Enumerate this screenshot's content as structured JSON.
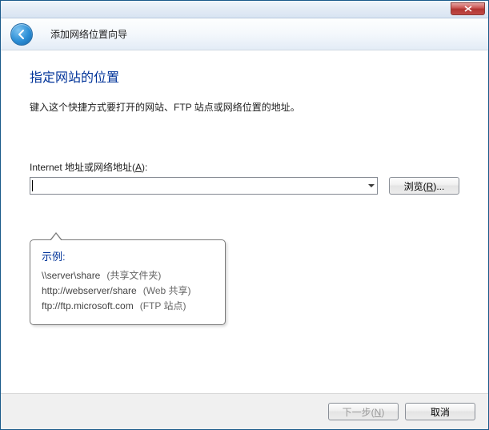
{
  "titlebar": {},
  "header": {
    "wizard_title": "添加网络位置向导"
  },
  "content": {
    "heading": "指定网站的位置",
    "instruction": "键入这个快捷方式要打开的网站、FTP 站点或网络位置的地址。",
    "field_label_prefix": "Internet 地址或网络地址(",
    "field_label_key": "A",
    "field_label_suffix": "):",
    "address_value": "",
    "browse_prefix": "浏览(",
    "browse_key": "R",
    "browse_suffix": ")..."
  },
  "tooltip": {
    "title": "示例:",
    "examples": [
      {
        "addr": "\\\\server\\share",
        "desc": "(共享文件夹)"
      },
      {
        "addr": "http://webserver/share",
        "desc": "(Web 共享)"
      },
      {
        "addr": "ftp://ftp.microsoft.com",
        "desc": "(FTP 站点)"
      }
    ]
  },
  "footer": {
    "next_prefix": "下一步(",
    "next_key": "N",
    "next_suffix": ")",
    "cancel": "取消"
  }
}
